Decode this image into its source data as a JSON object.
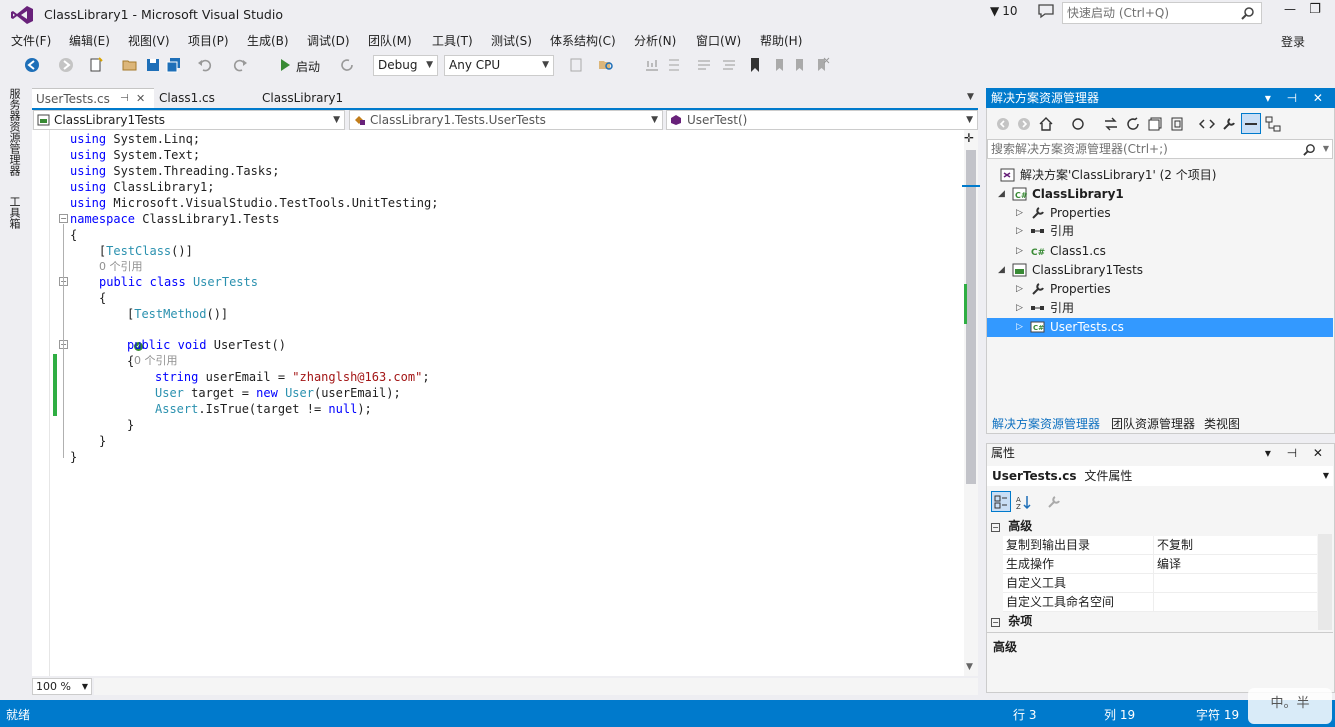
{
  "window": {
    "title": "ClassLibrary1 - Microsoft Visual Studio",
    "notification_count": "10",
    "quick_launch_placeholder": "快速启动 (Ctrl+Q)",
    "login": "登录",
    "min_glyph": "—",
    "max_glyph": "❐"
  },
  "menu": [
    "文件(F)",
    "编辑(E)",
    "视图(V)",
    "项目(P)",
    "生成(B)",
    "调试(D)",
    "团队(M)",
    "工具(T)",
    "测试(S)",
    "体系结构(C)",
    "分析(N)",
    "窗口(W)",
    "帮助(H)"
  ],
  "toolbar": {
    "start_label": "启动",
    "config": "Debug",
    "platform": "Any CPU"
  },
  "left_tabs": [
    "服务器资源管理器",
    "工具箱"
  ],
  "doc_tabs": {
    "active": "UserTests.cs",
    "active_pin": "⊣",
    "active_close": "✕",
    "others": [
      "Class1.cs",
      "ClassLibrary1"
    ]
  },
  "nav": {
    "project": "ClassLibrary1Tests",
    "type": "ClassLibrary1.Tests.UserTests",
    "member": "UserTest()"
  },
  "code": {
    "l1": [
      "using",
      " System.Linq;"
    ],
    "l2": [
      "using",
      " System.Text;"
    ],
    "l3": [
      "using",
      " System.Threading.Tasks;"
    ],
    "l4": [
      "using",
      " ClassLibrary1;"
    ],
    "l5": [
      "using",
      " Microsoft.VisualStudio.TestTools.UnitTesting;"
    ],
    "l6": [
      "namespace",
      " ClassLibrary1.Tests"
    ],
    "l7": "{",
    "l8": [
      "    [",
      "TestClass",
      "()]"
    ],
    "l9": "0 个引用",
    "l10": [
      "public",
      " ",
      "class",
      " ",
      "UserTests"
    ],
    "l11": "{",
    "l12": [
      "[",
      "TestMethod",
      "()]"
    ],
    "l13": "0 个引用",
    "l14": [
      "public",
      " ",
      "void",
      " UserTest()"
    ],
    "l15": "{",
    "l16": [
      "string",
      " userEmail = ",
      "\"zhanglsh@163.com\"",
      ";"
    ],
    "l17": [
      "User",
      " target = ",
      "new",
      " ",
      "User",
      "(userEmail);"
    ],
    "l18": [
      "Assert",
      ".IsTrue(target != ",
      "null",
      ");"
    ],
    "l19": "}",
    "l20": "}",
    "l21": "}"
  },
  "zoom": "100 %",
  "solution_explorer": {
    "title": "解决方案资源管理器",
    "header_controls": "▾ ⊣ ✕",
    "search_placeholder": "搜索解决方案资源管理器(Ctrl+;)",
    "solution": "解决方案'ClassLibrary1' (2 个项目)",
    "items": [
      {
        "label": "ClassLibrary1",
        "bold": true
      },
      {
        "label": "Properties"
      },
      {
        "label": "引用"
      },
      {
        "label": "Class1.cs"
      },
      {
        "label": "ClassLibrary1Tests"
      },
      {
        "label": "Properties"
      },
      {
        "label": "引用"
      },
      {
        "label": "UserTests.cs"
      }
    ],
    "bottom_tabs": [
      "解决方案资源管理器",
      "团队资源管理器",
      "类视图"
    ]
  },
  "properties": {
    "title": "属性",
    "header_controls": "▾ ⊣ ✕",
    "object_name": "UserTests.cs",
    "object_type": "文件属性",
    "cat_advanced": "高级",
    "rows": [
      {
        "name": "复制到输出目录",
        "value": "不复制"
      },
      {
        "name": "生成操作",
        "value": "编译"
      },
      {
        "name": "自定义工具",
        "value": ""
      },
      {
        "name": "自定义工具命名空间",
        "value": ""
      }
    ],
    "cat_misc": "杂项",
    "description": "高级"
  },
  "status": {
    "ready": "就绪",
    "line": "行 3",
    "col": "列 19",
    "char": "字符 19"
  },
  "watermark": "中。半",
  "colors": {
    "accent": "#007acc",
    "selection": "#3399ff",
    "keyword": "#0000ff",
    "type": "#2b91af",
    "string": "#a31515",
    "change_marker": "#2fae43"
  }
}
